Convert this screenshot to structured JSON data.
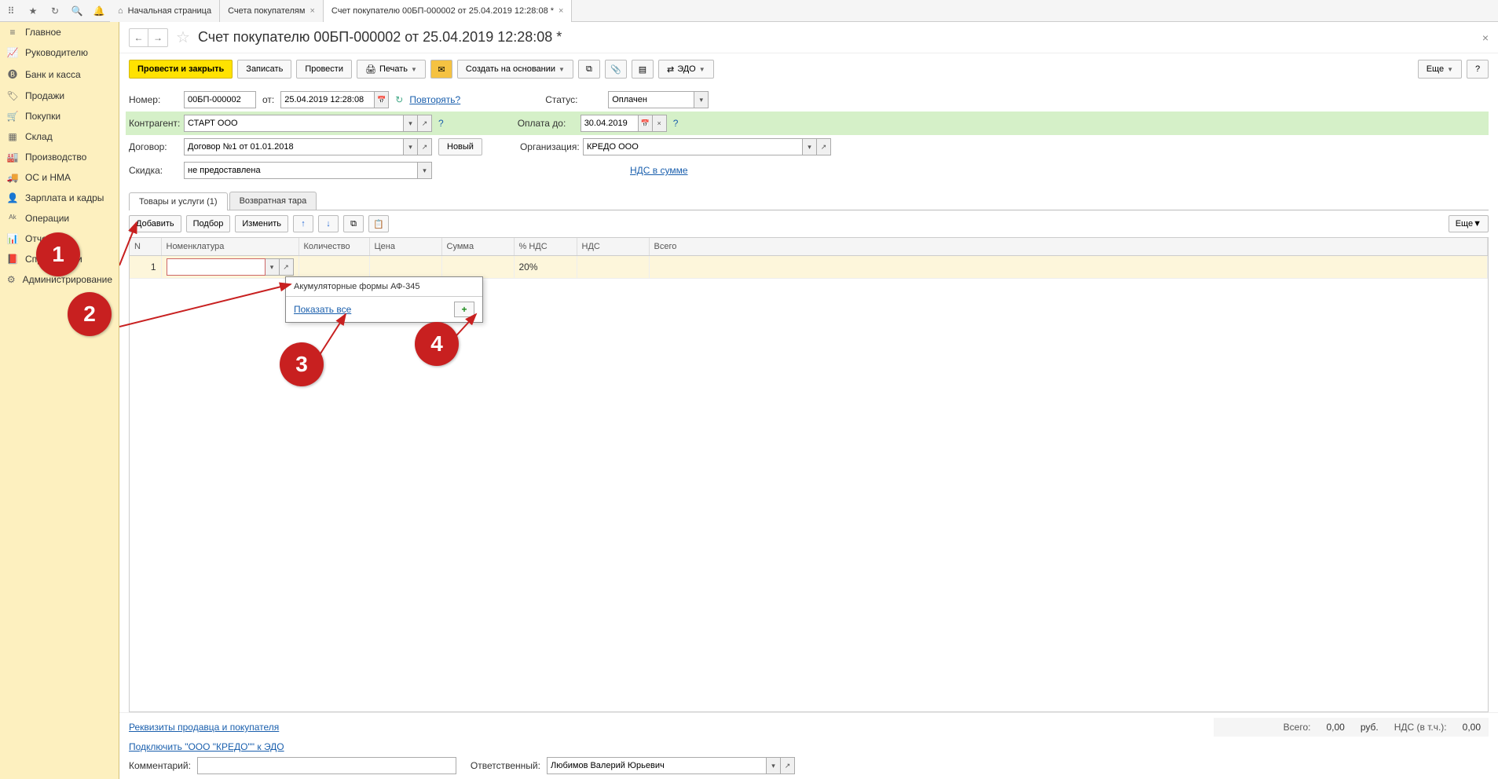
{
  "topTabs": {
    "home": "Начальная страница",
    "t1": "Счета покупателям",
    "t2": "Счет покупателю 00БП-000002 от 25.04.2019 12:28:08 *"
  },
  "sidebar": {
    "items": [
      {
        "icon": "≡",
        "label": "Главное"
      },
      {
        "icon": "📈",
        "label": "Руководителю"
      },
      {
        "icon": "🅑",
        "label": "Банк и касса"
      },
      {
        "icon": "🏷",
        "label": "Продажи"
      },
      {
        "icon": "🛒",
        "label": "Покупки"
      },
      {
        "icon": "▦",
        "label": "Склад"
      },
      {
        "icon": "🏭",
        "label": "Производство"
      },
      {
        "icon": "🚚",
        "label": "ОС и НМА"
      },
      {
        "icon": "👤",
        "label": "Зарплата и кадры"
      },
      {
        "icon": "ᴬᵏ",
        "label": "Операции"
      },
      {
        "icon": "📊",
        "label": "Отчеты"
      },
      {
        "icon": "📕",
        "label": "Справочники"
      },
      {
        "icon": "⚙",
        "label": "Администрирование"
      }
    ]
  },
  "doc": {
    "title": "Счет покупателю 00БП-000002 от 25.04.2019 12:28:08 *"
  },
  "actions": {
    "postClose": "Провести и закрыть",
    "save": "Записать",
    "post": "Провести",
    "print": "Печать",
    "createBased": "Создать на основании",
    "edo": "ЭДО",
    "more": "Еще",
    "help": "?"
  },
  "form": {
    "numberLabel": "Номер:",
    "number": "00БП-000002",
    "fromLabel": "от:",
    "date": "25.04.2019 12:28:08",
    "repeat": "Повторять?",
    "statusLabel": "Статус:",
    "status": "Оплачен",
    "counterpartyLabel": "Контрагент:",
    "counterparty": "СТАРТ ООО",
    "payUntilLabel": "Оплата до:",
    "payUntil": "30.04.2019",
    "contractLabel": "Договор:",
    "contract": "Договор №1 от 01.01.2018",
    "newBtn": "Новый",
    "orgLabel": "Организация:",
    "org": "КРЕДО ООО",
    "discountLabel": "Скидка:",
    "discount": "не предоставлена",
    "vatLink": "НДС в сумме"
  },
  "dataTabs": {
    "tab1": "Товары и услуги (1)",
    "tab2": "Возвратная тара"
  },
  "tableToolbar": {
    "add": "Добавить",
    "pick": "Подбор",
    "edit": "Изменить",
    "more": "Еще"
  },
  "columns": {
    "n": "N",
    "nom": "Номенклатура",
    "qty": "Количество",
    "price": "Цена",
    "sum": "Сумма",
    "vatPct": "% НДС",
    "vat": "НДС",
    "total": "Всего"
  },
  "row1": {
    "n": "1",
    "vatPct": "20%"
  },
  "dropdown": {
    "item1": "Акумуляторные формы АФ-345",
    "showAll": "Показать все"
  },
  "footer": {
    "sellerBuyerLink": "Реквизиты продавца и покупателя",
    "edoLink": "Подключить \"ООО \"КРЕДО\"\" к ЭДО",
    "totalLabel": "Всего:",
    "totalValue": "0,00",
    "currency": "руб.",
    "vatInclLabel": "НДС (в т.ч.):",
    "vatInclValue": "0,00",
    "commentLabel": "Комментарий:",
    "respLabel": "Ответственный:",
    "resp": "Любимов Валерий Юрьевич"
  },
  "annotations": {
    "c1": "1",
    "c2": "2",
    "c3": "3",
    "c4": "4"
  }
}
